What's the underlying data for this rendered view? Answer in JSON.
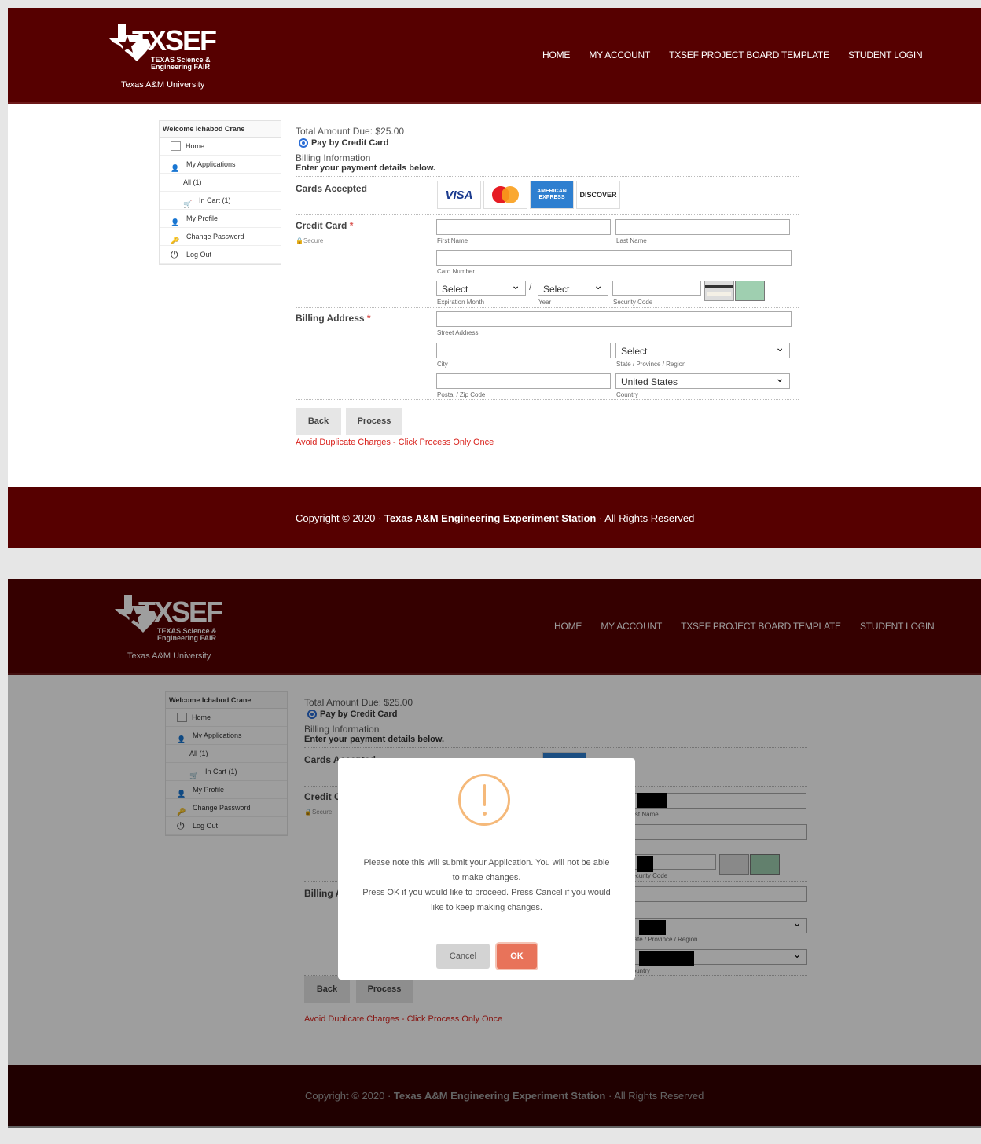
{
  "brand": {
    "logo_text": "TXSEF",
    "logo_sub1": "TEXAS Science &",
    "logo_sub2": "Engineering FAIR",
    "university": "Texas A&M University"
  },
  "nav": {
    "home": "HOME",
    "account": "MY ACCOUNT",
    "template": "TXSEF PROJECT BOARD TEMPLATE",
    "login": "STUDENT LOGIN"
  },
  "sidebar": {
    "welcome": "Welcome Ichabod Crane",
    "items": [
      "Home",
      "My Applications",
      "All (1)",
      "In Cart (1)",
      "My Profile",
      "Change Password",
      "Log Out"
    ]
  },
  "payment": {
    "total": "Total Amount Due: $25.00",
    "pay_method": "Pay by Credit Card",
    "billing_info": "Billing Information",
    "enter_details": "Enter your payment details below.",
    "cards_accepted": "Cards Accepted",
    "credit_card": "Credit Card",
    "secure": "Secure",
    "billing_address": "Billing Address",
    "req_mark": "*"
  },
  "cards": {
    "visa": "VISA",
    "mastercard": "MasterCard",
    "amex": "AMERICAN EXPRESS",
    "discover": "DISCOVER"
  },
  "fields": {
    "first_name": "First Name",
    "last_name": "Last Name",
    "card_number": "Card Number",
    "exp_month_value": "Select",
    "exp_month": "Expiration Month",
    "slash": "/",
    "year_value": "Select",
    "year": "Year",
    "security_code": "Security Code",
    "street": "Street Address",
    "city": "City",
    "state_value": "Select",
    "state": "State / Province / Region",
    "postal": "Postal / Zip Code",
    "country_value": "United States",
    "country": "Country"
  },
  "buttons": {
    "back": "Back",
    "process": "Process"
  },
  "warning": "Avoid Duplicate Charges - Click Process Only Once",
  "footer": {
    "prefix": "Copyright © 2020 · ",
    "org": "Texas A&M Engineering Experiment Station",
    "suffix": " · All Rights Reserved"
  },
  "modal": {
    "line1": "Please note this will submit your Application. You will not be able to make changes.",
    "line2": "Press OK if you would like to proceed. Press Cancel if you would like to keep making changes.",
    "cancel": "Cancel",
    "ok": "OK"
  },
  "colors": {
    "maroon": "#560000",
    "warning_red": "#d9221c",
    "ok_button": "#e8735a",
    "radio_blue": "#2a6dd6"
  }
}
